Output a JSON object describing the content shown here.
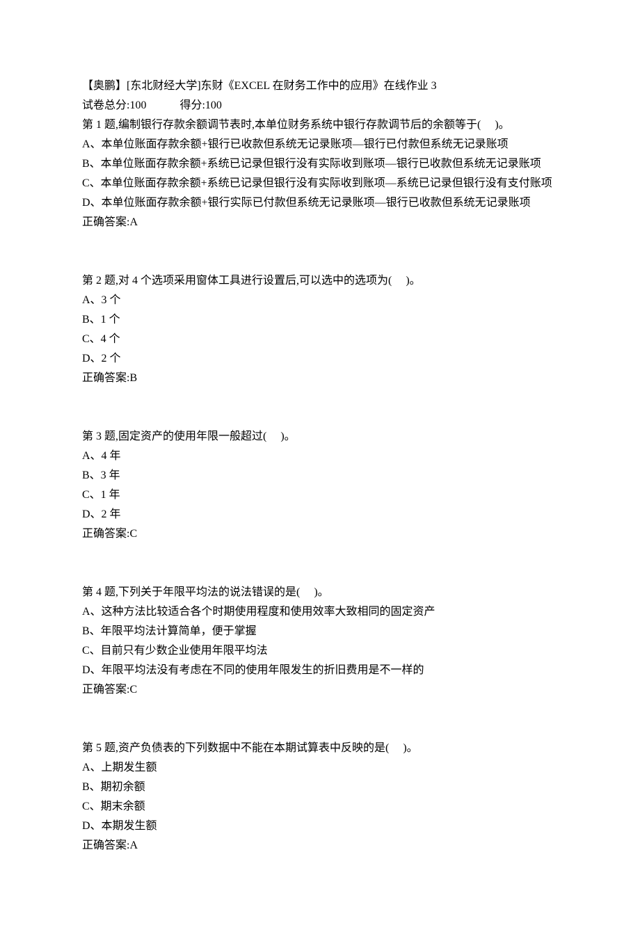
{
  "header": {
    "title": "【奥鹏】[东北财经大学]东财《EXCEL 在财务工作中的应用》在线作业 3",
    "total_label": "试卷总分:100",
    "score_label": "得分:100"
  },
  "questions": [
    {
      "stem": "第 1 题,编制银行存款余额调节表时,本单位财务系统中银行存款调节后的余额等于(　 )。",
      "options": [
        "A、本单位账面存款余额+银行已收款但系统无记录账项—银行已付款但系统无记录账项",
        "B、本单位账面存款余额+系统已记录但银行没有实际收到账项—银行已收款但系统无记录账项",
        "C、本单位账面存款余额+系统已记录但银行没有实际收到账项—系统已记录但银行没有支付账项",
        "D、本单位账面存款余额+银行实际已付款但系统无记录账项—银行已收款但系统无记录账项"
      ],
      "answer": "正确答案:A"
    },
    {
      "stem": "第 2 题,对 4 个选项采用窗体工具进行设置后,可以选中的选项为(　 )。",
      "options": [
        "A、3 个",
        "B、1 个",
        "C、4 个",
        "D、2 个"
      ],
      "answer": "正确答案:B"
    },
    {
      "stem": "第 3 题,固定资产的使用年限一般超过(　 )。",
      "options": [
        "A、4 年",
        "B、3 年",
        "C、1 年",
        "D、2 年"
      ],
      "answer": "正确答案:C"
    },
    {
      "stem": "第 4 题,下列关于年限平均法的说法错误的是(　 )。",
      "options": [
        "A、这种方法比较适合各个时期使用程度和使用效率大致相同的固定资产",
        "B、年限平均法计算简单，便于掌握",
        "C、目前只有少数企业使用年限平均法",
        "D、年限平均法没有考虑在不同的使用年限发生的折旧费用是不一样的"
      ],
      "answer": "正确答案:C"
    },
    {
      "stem": "第 5 题,资产负债表的下列数据中不能在本期试算表中反映的是(　 )。",
      "options": [
        "A、上期发生额",
        "B、期初余额",
        "C、期末余额",
        "D、本期发生额"
      ],
      "answer": "正确答案:A"
    }
  ]
}
